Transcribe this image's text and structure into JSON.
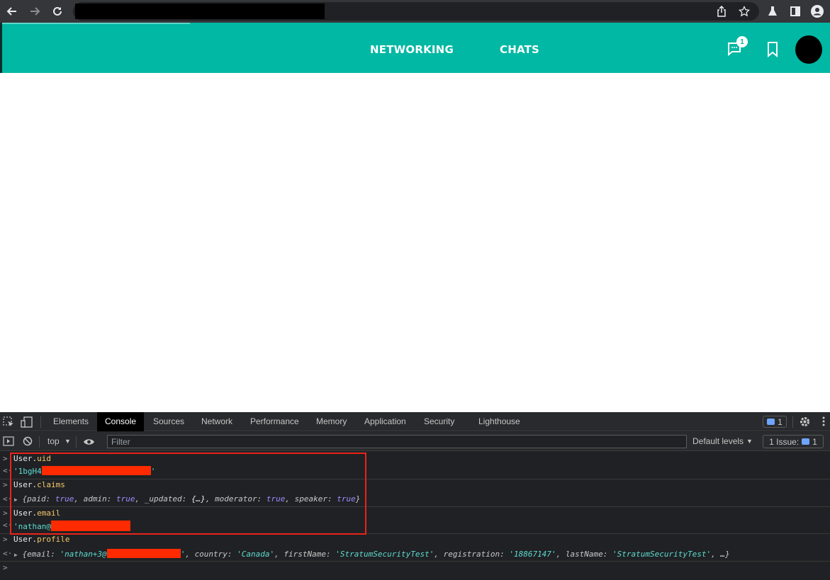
{
  "browser": {
    "icons": [
      "back-arrow-icon",
      "forward-arrow-icon",
      "reload-icon",
      "share-icon",
      "star-icon",
      "labs-flask-icon",
      "side-panel-icon",
      "profile-icon"
    ]
  },
  "header": {
    "brand_color": "#00b8a3",
    "nav": {
      "networking": "NETWORKING",
      "chats": "CHATS"
    },
    "chat_badge": "1"
  },
  "devtools": {
    "tabs": [
      "Elements",
      "Console",
      "Sources",
      "Network",
      "Performance",
      "Memory",
      "Application",
      "Security",
      "Lighthouse"
    ],
    "active_tab": "Console",
    "message_count": "1",
    "toolbar": {
      "context": "top",
      "filter_placeholder": "Filter",
      "levels": "Default levels",
      "issues": "1 Issue:",
      "issues_count": "1"
    },
    "console": {
      "uid_cmd_obj": "User",
      "uid_cmd_prop": "uid",
      "uid_result": "'1bgH4",
      "uid_result_end": "'",
      "claims_cmd_obj": "User",
      "claims_cmd_prop": "claims",
      "claims_result": {
        "paid_key": "paid",
        "paid_val": "true",
        "admin_key": "admin",
        "admin_val": "true",
        "updated_key": "_updated",
        "updated_val": "{…}",
        "moderator_key": "moderator",
        "moderator_val": "true",
        "speaker_key": "speaker",
        "speaker_val": "true"
      },
      "email_cmd_obj": "User",
      "email_cmd_prop": "email",
      "email_result": "'nathan@",
      "profile_cmd_obj": "User",
      "profile_cmd_prop": "profile",
      "profile_result": {
        "email_key": "email",
        "email_val": "'nathan+3@",
        "email_val_end": "'",
        "country_key": "country",
        "country_val": "'Canada'",
        "first_key": "firstName",
        "first_val": "'StratumSecurityTest'",
        "reg_key": "registration",
        "reg_val": "'18867147'",
        "last_key": "lastName",
        "last_val": "'StratumSecurityTest'",
        "ellipsis": "…"
      }
    }
  }
}
